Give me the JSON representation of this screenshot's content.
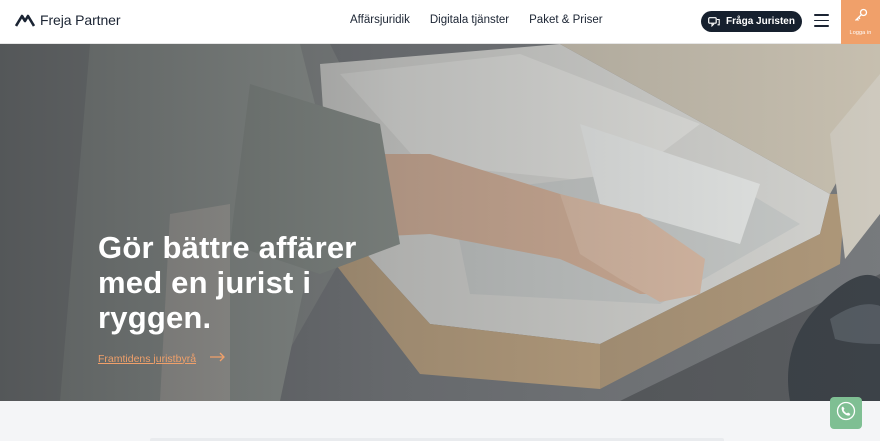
{
  "header": {
    "logo_text": "Freja Partner",
    "nav": [
      {
        "label": "Affärsjuridik"
      },
      {
        "label": "Digitala tjänster"
      },
      {
        "label": "Paket & Priser"
      }
    ],
    "ask_button": "Fråga Juristen",
    "login_label": "Logga in"
  },
  "hero": {
    "title": "Gör bättre affärer med en jurist i ryggen.",
    "link_text": "Framtidens juristbyrå"
  },
  "colors": {
    "accent": "#f0a06a",
    "dark": "#16202e",
    "phone": "#7fbf93"
  },
  "icons": {
    "logo": "freja-logo-icon",
    "ask": "chat-icon",
    "menu": "hamburger-icon",
    "login": "key-icon",
    "link": "arrow-right-icon",
    "phone": "phone-icon"
  }
}
